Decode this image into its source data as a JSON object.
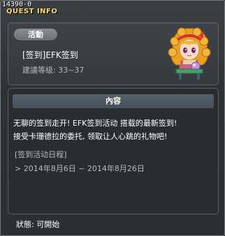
{
  "window": {
    "quest_id": "14390-0",
    "title": "QUEST INFO"
  },
  "header": {
    "status_badge": "活動",
    "quest_name": "[签到]EFK签到",
    "level_range": "建議等级: 33~37"
  },
  "content": {
    "section_title": "內容",
    "description_lines": [
      "无聊的签到走开! EFK签到活动 搭载的最新签到!",
      "接受卡珊德拉的委托, 领取让人心跳的礼物吧!"
    ],
    "schedule_label": "[签到活动日程]",
    "schedule_range": "> 2014年8月6日 ~ 2014年8月26日"
  },
  "footer": {
    "status_text": "狀態: 可開始"
  },
  "colors": {
    "title": "#f5d56a",
    "background": "#2b2e31",
    "section_header": "#4d5761",
    "badge": "#7d8083"
  }
}
